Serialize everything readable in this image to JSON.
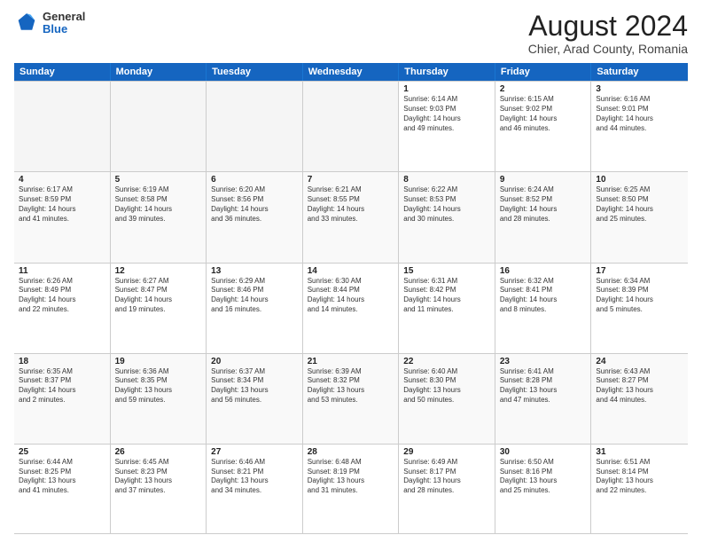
{
  "header": {
    "logo_general": "General",
    "logo_blue": "Blue",
    "main_title": "August 2024",
    "subtitle": "Chier, Arad County, Romania"
  },
  "days_of_week": [
    "Sunday",
    "Monday",
    "Tuesday",
    "Wednesday",
    "Thursday",
    "Friday",
    "Saturday"
  ],
  "weeks": [
    [
      {
        "day": "",
        "info": "",
        "empty": true
      },
      {
        "day": "",
        "info": "",
        "empty": true
      },
      {
        "day": "",
        "info": "",
        "empty": true
      },
      {
        "day": "",
        "info": "",
        "empty": true
      },
      {
        "day": "1",
        "info": "Sunrise: 6:14 AM\nSunset: 9:03 PM\nDaylight: 14 hours\nand 49 minutes.",
        "empty": false
      },
      {
        "day": "2",
        "info": "Sunrise: 6:15 AM\nSunset: 9:02 PM\nDaylight: 14 hours\nand 46 minutes.",
        "empty": false
      },
      {
        "day": "3",
        "info": "Sunrise: 6:16 AM\nSunset: 9:01 PM\nDaylight: 14 hours\nand 44 minutes.",
        "empty": false
      }
    ],
    [
      {
        "day": "4",
        "info": "Sunrise: 6:17 AM\nSunset: 8:59 PM\nDaylight: 14 hours\nand 41 minutes.",
        "empty": false
      },
      {
        "day": "5",
        "info": "Sunrise: 6:19 AM\nSunset: 8:58 PM\nDaylight: 14 hours\nand 39 minutes.",
        "empty": false
      },
      {
        "day": "6",
        "info": "Sunrise: 6:20 AM\nSunset: 8:56 PM\nDaylight: 14 hours\nand 36 minutes.",
        "empty": false
      },
      {
        "day": "7",
        "info": "Sunrise: 6:21 AM\nSunset: 8:55 PM\nDaylight: 14 hours\nand 33 minutes.",
        "empty": false
      },
      {
        "day": "8",
        "info": "Sunrise: 6:22 AM\nSunset: 8:53 PM\nDaylight: 14 hours\nand 30 minutes.",
        "empty": false
      },
      {
        "day": "9",
        "info": "Sunrise: 6:24 AM\nSunset: 8:52 PM\nDaylight: 14 hours\nand 28 minutes.",
        "empty": false
      },
      {
        "day": "10",
        "info": "Sunrise: 6:25 AM\nSunset: 8:50 PM\nDaylight: 14 hours\nand 25 minutes.",
        "empty": false
      }
    ],
    [
      {
        "day": "11",
        "info": "Sunrise: 6:26 AM\nSunset: 8:49 PM\nDaylight: 14 hours\nand 22 minutes.",
        "empty": false
      },
      {
        "day": "12",
        "info": "Sunrise: 6:27 AM\nSunset: 8:47 PM\nDaylight: 14 hours\nand 19 minutes.",
        "empty": false
      },
      {
        "day": "13",
        "info": "Sunrise: 6:29 AM\nSunset: 8:46 PM\nDaylight: 14 hours\nand 16 minutes.",
        "empty": false
      },
      {
        "day": "14",
        "info": "Sunrise: 6:30 AM\nSunset: 8:44 PM\nDaylight: 14 hours\nand 14 minutes.",
        "empty": false
      },
      {
        "day": "15",
        "info": "Sunrise: 6:31 AM\nSunset: 8:42 PM\nDaylight: 14 hours\nand 11 minutes.",
        "empty": false
      },
      {
        "day": "16",
        "info": "Sunrise: 6:32 AM\nSunset: 8:41 PM\nDaylight: 14 hours\nand 8 minutes.",
        "empty": false
      },
      {
        "day": "17",
        "info": "Sunrise: 6:34 AM\nSunset: 8:39 PM\nDaylight: 14 hours\nand 5 minutes.",
        "empty": false
      }
    ],
    [
      {
        "day": "18",
        "info": "Sunrise: 6:35 AM\nSunset: 8:37 PM\nDaylight: 14 hours\nand 2 minutes.",
        "empty": false
      },
      {
        "day": "19",
        "info": "Sunrise: 6:36 AM\nSunset: 8:35 PM\nDaylight: 13 hours\nand 59 minutes.",
        "empty": false
      },
      {
        "day": "20",
        "info": "Sunrise: 6:37 AM\nSunset: 8:34 PM\nDaylight: 13 hours\nand 56 minutes.",
        "empty": false
      },
      {
        "day": "21",
        "info": "Sunrise: 6:39 AM\nSunset: 8:32 PM\nDaylight: 13 hours\nand 53 minutes.",
        "empty": false
      },
      {
        "day": "22",
        "info": "Sunrise: 6:40 AM\nSunset: 8:30 PM\nDaylight: 13 hours\nand 50 minutes.",
        "empty": false
      },
      {
        "day": "23",
        "info": "Sunrise: 6:41 AM\nSunset: 8:28 PM\nDaylight: 13 hours\nand 47 minutes.",
        "empty": false
      },
      {
        "day": "24",
        "info": "Sunrise: 6:43 AM\nSunset: 8:27 PM\nDaylight: 13 hours\nand 44 minutes.",
        "empty": false
      }
    ],
    [
      {
        "day": "25",
        "info": "Sunrise: 6:44 AM\nSunset: 8:25 PM\nDaylight: 13 hours\nand 41 minutes.",
        "empty": false
      },
      {
        "day": "26",
        "info": "Sunrise: 6:45 AM\nSunset: 8:23 PM\nDaylight: 13 hours\nand 37 minutes.",
        "empty": false
      },
      {
        "day": "27",
        "info": "Sunrise: 6:46 AM\nSunset: 8:21 PM\nDaylight: 13 hours\nand 34 minutes.",
        "empty": false
      },
      {
        "day": "28",
        "info": "Sunrise: 6:48 AM\nSunset: 8:19 PM\nDaylight: 13 hours\nand 31 minutes.",
        "empty": false
      },
      {
        "day": "29",
        "info": "Sunrise: 6:49 AM\nSunset: 8:17 PM\nDaylight: 13 hours\nand 28 minutes.",
        "empty": false
      },
      {
        "day": "30",
        "info": "Sunrise: 6:50 AM\nSunset: 8:16 PM\nDaylight: 13 hours\nand 25 minutes.",
        "empty": false
      },
      {
        "day": "31",
        "info": "Sunrise: 6:51 AM\nSunset: 8:14 PM\nDaylight: 13 hours\nand 22 minutes.",
        "empty": false
      }
    ]
  ]
}
